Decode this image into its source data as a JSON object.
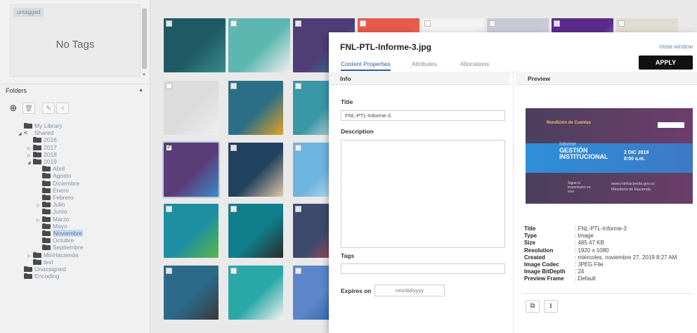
{
  "left_panel": {
    "tag_chip": "untagged",
    "no_tags": "No Tags",
    "folders_header": "Folders",
    "tree": [
      {
        "label": "My Library",
        "level": 0,
        "toggle": "",
        "type": "folder"
      },
      {
        "label": "Shared",
        "level": 0,
        "toggle": "◢",
        "type": "share"
      },
      {
        "label": "2016",
        "level": 1,
        "toggle": "",
        "type": "folder"
      },
      {
        "label": "2017",
        "level": 1,
        "toggle": "▷",
        "type": "folder"
      },
      {
        "label": "2018",
        "level": 1,
        "toggle": "▷",
        "type": "folder"
      },
      {
        "label": "2019",
        "level": 1,
        "toggle": "◢",
        "type": "folder"
      },
      {
        "label": "Abril",
        "level": 2,
        "toggle": "",
        "type": "folder"
      },
      {
        "label": "Agosto",
        "level": 2,
        "toggle": "",
        "type": "folder"
      },
      {
        "label": "Diciembre",
        "level": 2,
        "toggle": "",
        "type": "folder"
      },
      {
        "label": "Enero",
        "level": 2,
        "toggle": "",
        "type": "folder"
      },
      {
        "label": "Febrero",
        "level": 2,
        "toggle": "",
        "type": "folder"
      },
      {
        "label": "Julio",
        "level": 2,
        "toggle": "▷",
        "type": "folder"
      },
      {
        "label": "Junio",
        "level": 2,
        "toggle": "",
        "type": "folder"
      },
      {
        "label": "Marzo",
        "level": 2,
        "toggle": "▷",
        "type": "folder"
      },
      {
        "label": "Mayo",
        "level": 2,
        "toggle": "",
        "type": "folder"
      },
      {
        "label": "Noviembre",
        "level": 2,
        "toggle": "",
        "type": "folder",
        "selected": true
      },
      {
        "label": "Octubre",
        "level": 2,
        "toggle": "",
        "type": "folder"
      },
      {
        "label": "Septiembre",
        "level": 2,
        "toggle": "",
        "type": "folder"
      },
      {
        "label": "MinHacienda",
        "level": 1,
        "toggle": "▷",
        "type": "folder"
      },
      {
        "label": "test",
        "level": 1,
        "toggle": "",
        "type": "folder"
      },
      {
        "label": "Unassigned",
        "level": 0,
        "toggle": "",
        "type": "unassigned"
      },
      {
        "label": "Encoding",
        "level": 0,
        "toggle": "",
        "type": "encoding"
      }
    ]
  },
  "thumbnails": [
    {
      "colors": [
        "#1f5a64",
        "#3a8a8e"
      ],
      "checked": false
    },
    {
      "colors": [
        "#5bb7b0",
        "#f0f0f0"
      ],
      "checked": false
    },
    {
      "colors": [
        "#4f3d76",
        "#2b8a9a"
      ],
      "checked": false
    },
    {
      "colors": [
        "#e55b4b",
        "#f4a24b"
      ],
      "checked": false
    },
    {
      "colors": [
        "#f3f3f3",
        "#d9d9d9"
      ],
      "checked": false
    },
    {
      "colors": [
        "#c9c9d8",
        "#e5e5ea"
      ],
      "checked": false
    },
    {
      "colors": [
        "#5a2a8c",
        "#d8cde8"
      ],
      "checked": false
    },
    {
      "colors": [
        "#e0dcd2",
        "#ece9e2"
      ],
      "checked": false
    },
    {
      "colors": [
        "#dcdcdc",
        "#efefef"
      ],
      "checked": false
    },
    {
      "colors": [
        "#2b6f87",
        "#e4a125"
      ],
      "checked": false
    },
    {
      "colors": [
        "#3a97a6",
        "#e8e8e8"
      ],
      "checked": false
    },
    {
      "colors": [
        "#5a3d78",
        "#3d89c9"
      ],
      "checked": true
    },
    {
      "colors": [
        "#21415f",
        "#e0c7a3"
      ],
      "checked": false
    },
    {
      "colors": [
        "#6db4de",
        "#d9ecf7"
      ],
      "checked": false
    },
    {
      "colors": [
        "#1e8fa2",
        "#5ab748"
      ],
      "checked": false
    },
    {
      "colors": [
        "#0f7f8c",
        "#2a2a2a"
      ],
      "checked": false
    },
    {
      "colors": [
        "#3b4a6b",
        "#c9474f"
      ],
      "checked": false
    },
    {
      "colors": [
        "#2d6a8a",
        "#3a3a3a"
      ],
      "checked": false
    },
    {
      "colors": [
        "#29a8a7",
        "#f2f2f2"
      ],
      "checked": false
    },
    {
      "colors": [
        "#8fc8e8",
        "#eaf4fa"
      ],
      "checked": false
    },
    {
      "colors": [
        "#5b86c9",
        "#1c5a9a"
      ],
      "checked": false
    }
  ],
  "modal": {
    "title": "FNL-PTL-Informe-3.jpg",
    "close_label": "close window",
    "apply_label": "APPLY",
    "tabs": [
      "Content Properties",
      "Attributes",
      "Allocations"
    ],
    "info_header": "Info",
    "preview_header": "Preview",
    "fields": {
      "title_label": "Title",
      "title_value": "FNL-PTL-Informe-3",
      "description_label": "Description",
      "tags_label": "Tags",
      "expires_label": "Expires on",
      "expires_placeholder": "mm/dd/yyyy"
    },
    "preview_image": {
      "brand": "Rendición de Cuentas",
      "line1": "Informe",
      "line2": "GESTIÓN",
      "line3": "INSTITUCIONAL",
      "date": "2 DIC 2019",
      "time": "8:00 a.m.",
      "site": "www.minhacienda.gov.co",
      "ministry": "Ministerio de Hacienda",
      "follow": "Sigue la transmisión en vivo"
    },
    "metadata": [
      {
        "key": "Title",
        "value": ": FNL-PTL-Informe-3"
      },
      {
        "key": "Type",
        "value": ": Image"
      },
      {
        "key": "Size",
        "value": ": 485.47 KB"
      },
      {
        "key": "Resolution",
        "value": ": 1920 x 1080"
      },
      {
        "key": "Created",
        "value": ": miércoles, noviembre 27, 2019 8:27 AM"
      },
      {
        "key": "Image Codec",
        "value": ": JPEG File"
      },
      {
        "key": "Image BitDepth",
        "value": ": 24"
      },
      {
        "key": "Preview Frame",
        "value": ": Default"
      }
    ]
  }
}
